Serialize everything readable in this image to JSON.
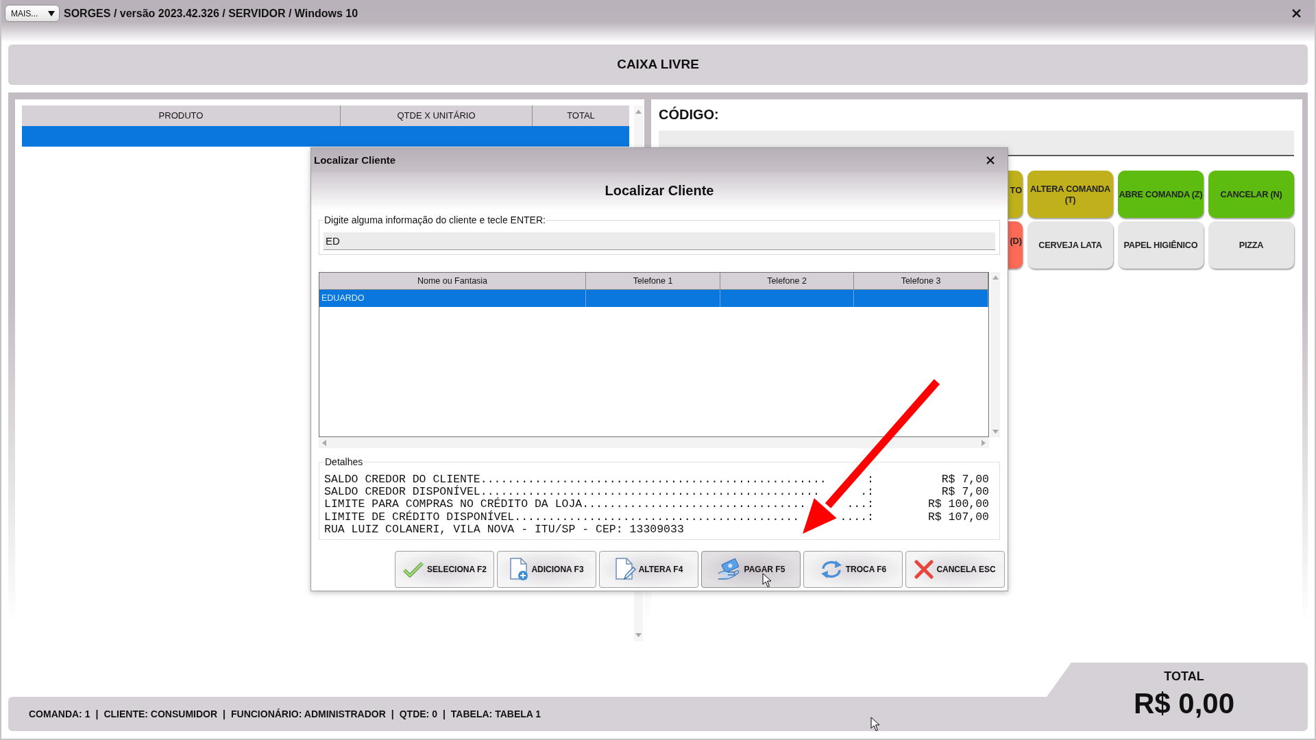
{
  "window": {
    "menu_button": "MAIS...",
    "title": "SORGES / versão 2023.42.326 / SERVIDOR / Windows 10"
  },
  "header": {
    "title": "CAIXA LIVRE"
  },
  "order_table": {
    "columns": [
      "PRODUTO",
      "QTDE X UNITÁRIO",
      "TOTAL"
    ],
    "rows": [
      {
        "selected": true
      }
    ]
  },
  "code_field": {
    "label": "CÓDIGO:"
  },
  "quick_buttons": {
    "rows": [
      {
        "buttons": [
          {
            "label": "TO",
            "color": "#bfb01c"
          },
          {
            "label": "ALTERA COMANDA (T)",
            "color": "#bfb01c"
          },
          {
            "label": "ABRE COMANDA (Z)",
            "color": "#5ebb10"
          },
          {
            "label": "CANCELAR (N)",
            "color": "#5ebb10"
          }
        ]
      },
      {
        "buttons": [
          {
            "label": "(D)",
            "color": "#fd6b57"
          },
          {
            "label": "CERVEJA LATA",
            "color": "#e6e6e6"
          },
          {
            "label": "PAPEL HIGIÊNICO",
            "color": "#e6e6e6"
          },
          {
            "label": "PIZZA",
            "color": "#e6e6e6"
          }
        ]
      }
    ]
  },
  "dialog": {
    "title": "Localizar Cliente",
    "heading": "Localizar Cliente",
    "search": {
      "label": "Digite alguma informação do cliente e tecle ENTER:",
      "value": "ED"
    },
    "results": {
      "columns": [
        "Nome ou Fantasia",
        "Telefone 1",
        "Telefone 2",
        "Telefone 3"
      ],
      "rows": [
        {
          "name": "EDUARDO",
          "selected": true
        }
      ]
    },
    "details": {
      "label": "Detalhes",
      "lines": [
        {
          "kind": "amount",
          "label": "SALDO CREDOR DO CLIENTE...................................................",
          "tail": ":",
          "value": "R$ 7,00"
        },
        {
          "kind": "amount",
          "label": "SALDO CREDOR DISPONÍVEL..................................................",
          "tail": ".:",
          "value": "R$ 7,00"
        },
        {
          "kind": "amount",
          "label": "LIMITE PARA COMPRAS NO CRÉDITO DA LOJA.................................",
          "tail": "...:",
          "value": "R$ 100,00"
        },
        {
          "kind": "amount",
          "label": "LIMITE DE CRÉDITO DISPONÍVEL..........................................",
          "tail": "....:",
          "value": "R$ 107,00"
        },
        {
          "kind": "text",
          "text": "RUA LUIZ COLANERI, VILA NOVA - ITU/SP - CEP: 13309033"
        }
      ]
    },
    "buttons": [
      {
        "label": "SELECIONA F2",
        "hovered": false
      },
      {
        "label": "ADICIONA F3",
        "hovered": false
      },
      {
        "label": "ALTERA F4",
        "hovered": false
      },
      {
        "label": "PAGAR F5",
        "hovered": true
      },
      {
        "label": "TROCA F6",
        "hovered": false
      },
      {
        "label": "CANCELA ESC",
        "hovered": false
      }
    ]
  },
  "total": {
    "label": "TOTAL",
    "value": "R$ 0,00"
  },
  "status_bar": {
    "fields": [
      "COMANDA: 1",
      "CLIENTE: CONSUMIDOR",
      "FUNCIONÁRIO: ADMINISTRADOR",
      "QTDE: 0",
      "TABELA: TABELA 1"
    ],
    "separator": "|"
  }
}
